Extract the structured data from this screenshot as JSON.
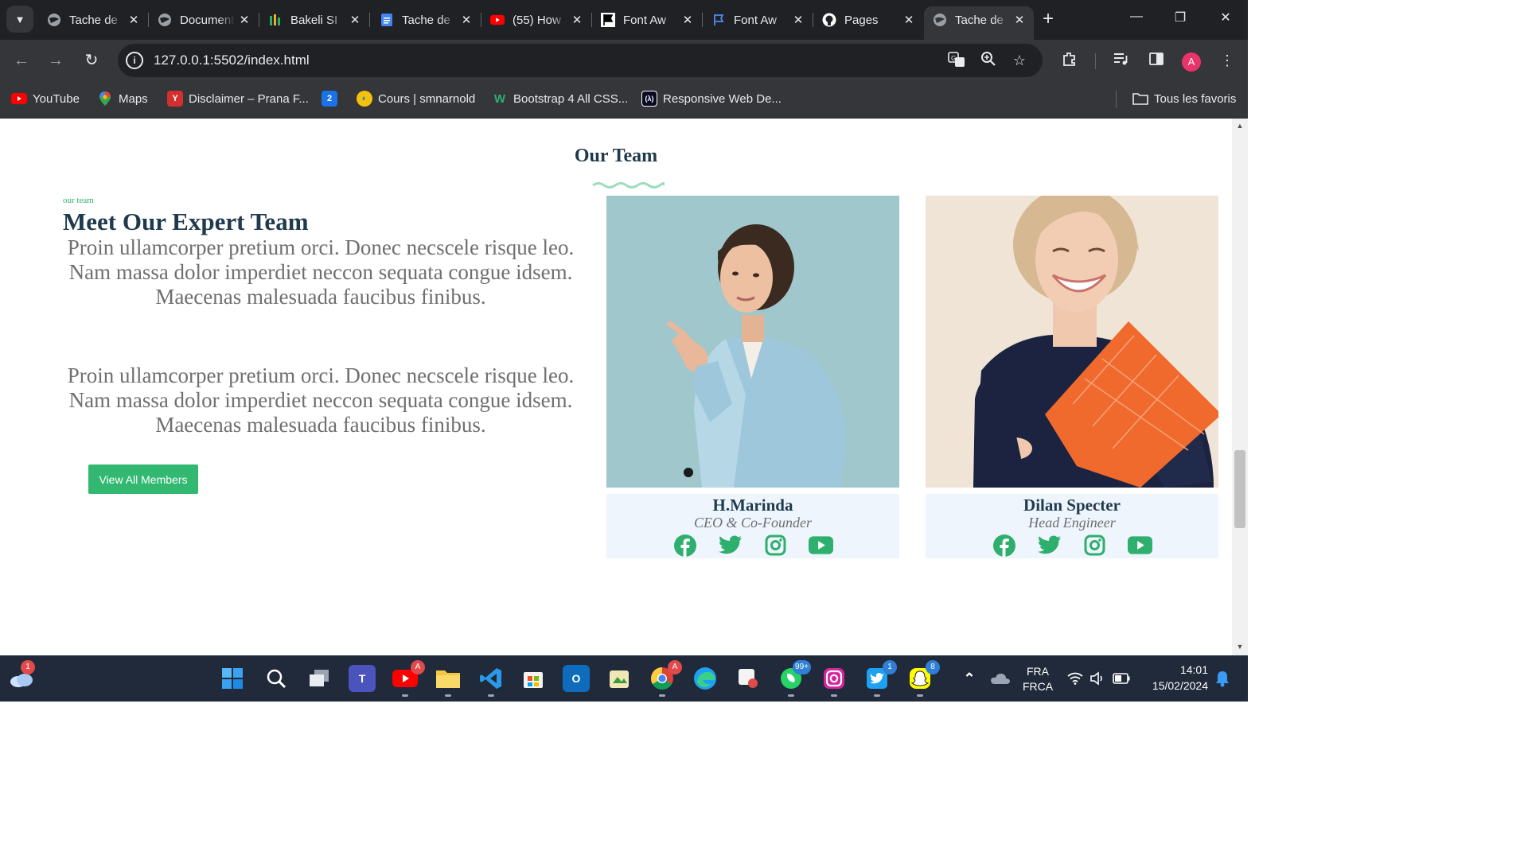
{
  "browser": {
    "tabs": [
      {
        "title": "Tache de",
        "icon": "globe-icon"
      },
      {
        "title": "Document",
        "icon": "globe-icon"
      },
      {
        "title": "Bakeli SI",
        "icon": "bakeli-icon"
      },
      {
        "title": "Tache de",
        "icon": "docs-icon"
      },
      {
        "title": "(55) How",
        "icon": "youtube-icon"
      },
      {
        "title": "Font Aw",
        "icon": "flag-icon"
      },
      {
        "title": "Font Aw",
        "icon": "flag-outline-icon"
      },
      {
        "title": "Pages",
        "icon": "github-icon"
      },
      {
        "title": "Tache de",
        "icon": "globe-icon",
        "active": true
      }
    ],
    "url": "127.0.0.1:5502/index.html",
    "profile_initial": "A",
    "bookmarks": [
      {
        "label": "YouTube",
        "icon": "youtube-icon"
      },
      {
        "label": "Maps",
        "icon": "maps-icon"
      },
      {
        "label": "Disclaimer – Prana F...",
        "icon": "prana-icon"
      },
      {
        "label": "",
        "icon": "number-2-icon"
      },
      {
        "label": "Cours | smnarnold",
        "icon": "cours-icon"
      },
      {
        "label": "Bootstrap 4 All CSS...",
        "icon": "w-icon"
      },
      {
        "label": "Responsive Web De...",
        "icon": "fcc-icon"
      }
    ],
    "all_bookmarks_label": "Tous les favoris"
  },
  "page": {
    "section_title": "Our Team",
    "eyebrow": "our team",
    "heading": "Meet Our Expert Team",
    "paragraph_1": "Proin ullamcorper pretium orci. Donec necscele risque leo. Nam massa dolor imperdiet neccon sequata congue idsem. Maecenas malesuada faucibus finibus.",
    "paragraph_2": "Proin ullamcorper pretium orci. Donec necscele risque leo. Nam massa dolor imperdiet neccon sequata congue idsem. Maecenas malesuada faucibus finibus.",
    "button_label": "View All Members",
    "accent_color": "#33b872",
    "members": [
      {
        "name": "H.Marinda",
        "role": "CEO & Co-Founder"
      },
      {
        "name": "Dilan Specter",
        "role": "Head Engineer"
      }
    ],
    "social_icons": [
      "facebook-icon",
      "twitter-icon",
      "instagram-icon",
      "youtube-icon"
    ]
  },
  "taskbar": {
    "weather_badge": "1",
    "youtube_badge": "A",
    "chrome_badge": "A",
    "whatsapp_badge": "99+",
    "twitter_badge": "1",
    "snapchat_badge": "8",
    "language_line1": "FRA",
    "language_line2": "FRCA",
    "time": "14:01",
    "date": "15/02/2024"
  }
}
